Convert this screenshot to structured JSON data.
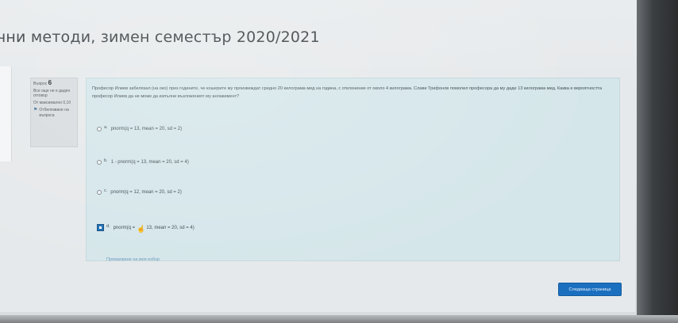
{
  "page": {
    "course_title": "чни методи, зимен семестър 2020/2021"
  },
  "question_info": {
    "label": "Въпрос",
    "number": "6",
    "status": "Все още не е даден отговор",
    "points": "От максимално 0,10",
    "flag_label": "Отбелязване на въпроса"
  },
  "question": {
    "text": "Професор Илиев забелязал (на око) през годините, че кошерите му произвеждат средно 20 килограма мед на година, с отклонение от около 4 килограма. Слави Трифонов помолил професора да му даде 13 килограма мед. Каква е вероятността професор Илиев да не може да изпълни възложеният му ангажимент?",
    "options": [
      {
        "letter": "a.",
        "text": "pnorm(q = 13, mean = 20, sd = 2)",
        "selected": false
      },
      {
        "letter": "b.",
        "text": "1 - pnorm(q = 13, mean = 20, sd = 4)",
        "selected": false
      },
      {
        "letter": "c.",
        "text": "pnorm(q = 12, mean = 20, sd = 2)",
        "selected": false
      },
      {
        "letter": "d.",
        "text_before": "pnorm(q = ",
        "text_after": "13, mean = 20, sd = 4)",
        "selected": true
      }
    ],
    "clear_label": "Премахване на моя избор"
  },
  "navigation": {
    "next_label": "Следваща страница"
  },
  "colors": {
    "accent": "#1b6fbf",
    "content_bg": "#d5e6ea",
    "link": "#6e9bbd"
  },
  "icons": {
    "flag": "flag-icon",
    "cursor": "mouse-cursor-icon"
  }
}
